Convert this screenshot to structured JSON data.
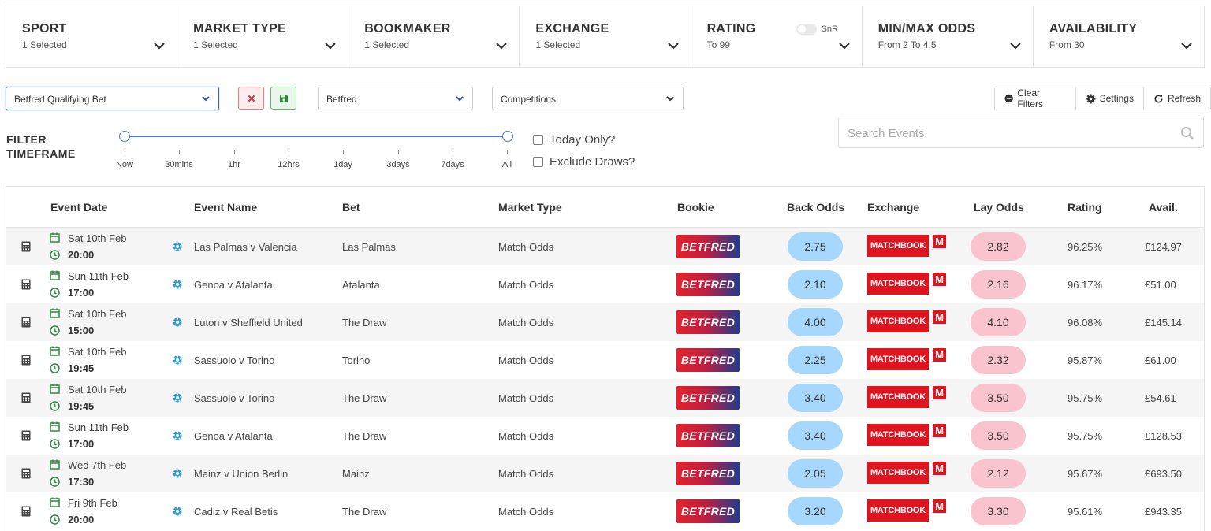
{
  "filters": [
    {
      "title": "SPORT",
      "value": "1 Selected"
    },
    {
      "title": "MARKET TYPE",
      "value": "1 Selected"
    },
    {
      "title": "BOOKMAKER",
      "value": "1 Selected"
    },
    {
      "title": "EXCHANGE",
      "value": "1 Selected"
    },
    {
      "title": "RATING",
      "value": "To 99",
      "toggle_label": "SnR"
    },
    {
      "title": "MIN/MAX ODDS",
      "value": "From 2 To 4.5"
    },
    {
      "title": "AVAILABILITY",
      "value": "From 30"
    }
  ],
  "controls": {
    "saved_filter": "Betfred Qualifying Bet",
    "bookmaker_select": "Betfred",
    "competitions_select": "Competitions",
    "clear_filters": "Clear Filters",
    "settings": "Settings",
    "refresh": "Refresh",
    "search_placeholder": "Search Events"
  },
  "timeframe": {
    "label_line1": "FILTER",
    "label_line2": "TIMEFRAME",
    "ticks": [
      "Now",
      "30mins",
      "1hr",
      "12hrs",
      "1day",
      "3days",
      "7days",
      "All"
    ],
    "selected_range": [
      "Now",
      "All"
    ]
  },
  "checkboxes": {
    "today_only": "Today Only?",
    "exclude_draws": "Exclude Draws?"
  },
  "table": {
    "headers": {
      "event_date": "Event Date",
      "event_name": "Event Name",
      "bet": "Bet",
      "market_type": "Market Type",
      "bookie": "Bookie",
      "back_odds": "Back Odds",
      "exchange": "Exchange",
      "lay_odds": "Lay Odds",
      "rating": "Rating",
      "avail": "Avail."
    },
    "bookie_logo": "BETFRED",
    "exchange_logo": "MATCHBOOK",
    "exchange_mark": "M",
    "rows": [
      {
        "date": "Sat 10th Feb",
        "time": "20:00",
        "event": "Las Palmas v Valencia",
        "bet": "Las Palmas",
        "market": "Match Odds",
        "back": "2.75",
        "lay": "2.82",
        "rating": "96.25%",
        "avail": "£124.97"
      },
      {
        "date": "Sun 11th Feb",
        "time": "17:00",
        "event": "Genoa v Atalanta",
        "bet": "Atalanta",
        "market": "Match Odds",
        "back": "2.10",
        "lay": "2.16",
        "rating": "96.17%",
        "avail": "£51.00"
      },
      {
        "date": "Sat 10th Feb",
        "time": "15:00",
        "event": "Luton v Sheffield United",
        "bet": "The Draw",
        "market": "Match Odds",
        "back": "4.00",
        "lay": "4.10",
        "rating": "96.08%",
        "avail": "£145.14"
      },
      {
        "date": "Sat 10th Feb",
        "time": "19:45",
        "event": "Sassuolo v Torino",
        "bet": "Torino",
        "market": "Match Odds",
        "back": "2.25",
        "lay": "2.32",
        "rating": "95.87%",
        "avail": "£61.00"
      },
      {
        "date": "Sat 10th Feb",
        "time": "19:45",
        "event": "Sassuolo v Torino",
        "bet": "The Draw",
        "market": "Match Odds",
        "back": "3.40",
        "lay": "3.50",
        "rating": "95.75%",
        "avail": "£54.61"
      },
      {
        "date": "Sun 11th Feb",
        "time": "17:00",
        "event": "Genoa v Atalanta",
        "bet": "The Draw",
        "market": "Match Odds",
        "back": "3.40",
        "lay": "3.50",
        "rating": "95.75%",
        "avail": "£128.53"
      },
      {
        "date": "Wed 7th Feb",
        "time": "17:30",
        "event": "Mainz v Union Berlin",
        "bet": "Mainz",
        "market": "Match Odds",
        "back": "2.05",
        "lay": "2.12",
        "rating": "95.67%",
        "avail": "£693.50"
      },
      {
        "date": "Fri 9th Feb",
        "time": "20:00",
        "event": "Cadiz v Real Betis",
        "bet": "The Draw",
        "market": "Match Odds",
        "back": "3.20",
        "lay": "3.30",
        "rating": "95.61%",
        "avail": "£943.35"
      }
    ]
  },
  "colors": {
    "accent_blue": "#4a76d0",
    "back_pill": "#a6d8fd",
    "lay_pill": "#fac4cf",
    "matchbook_red": "#e0141e",
    "calendar_green": "#2e8b3e",
    "soccer_blue": "#2a9fd8"
  }
}
